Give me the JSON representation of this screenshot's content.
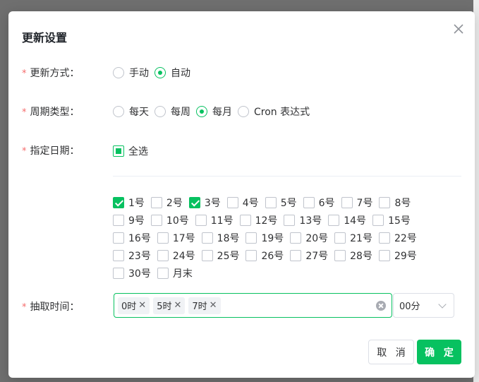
{
  "dialog": {
    "title": "更新设置",
    "cancel_label": "取 消",
    "confirm_label": "确 定"
  },
  "form": {
    "required_mark": "*",
    "update_mode": {
      "label": "更新方式：",
      "options": [
        {
          "label": "手动",
          "selected": false
        },
        {
          "label": "自动",
          "selected": true
        }
      ]
    },
    "period_type": {
      "label": "周期类型：",
      "options": [
        {
          "label": "每天",
          "selected": false
        },
        {
          "label": "每周",
          "selected": false
        },
        {
          "label": "每月",
          "selected": true
        },
        {
          "label": "Cron 表达式",
          "selected": false
        }
      ]
    },
    "dates": {
      "label": "指定日期：",
      "select_all_label": "全选",
      "select_all_state": "indeterminate",
      "rows": [
        [
          {
            "label": "1号",
            "checked": true
          },
          {
            "label": "2号",
            "checked": false
          },
          {
            "label": "3号",
            "checked": true
          },
          {
            "label": "4号",
            "checked": false
          },
          {
            "label": "5号",
            "checked": false
          },
          {
            "label": "6号",
            "checked": false
          },
          {
            "label": "7号",
            "checked": false
          },
          {
            "label": "8号",
            "checked": false
          }
        ],
        [
          {
            "label": "9号",
            "checked": false
          },
          {
            "label": "10号",
            "checked": false
          },
          {
            "label": "11号",
            "checked": false
          },
          {
            "label": "12号",
            "checked": false
          },
          {
            "label": "13号",
            "checked": false
          },
          {
            "label": "14号",
            "checked": false
          },
          {
            "label": "15号",
            "checked": false
          }
        ],
        [
          {
            "label": "16号",
            "checked": false
          },
          {
            "label": "17号",
            "checked": false
          },
          {
            "label": "18号",
            "checked": false
          },
          {
            "label": "19号",
            "checked": false
          },
          {
            "label": "20号",
            "checked": false
          },
          {
            "label": "21号",
            "checked": false
          },
          {
            "label": "22号",
            "checked": false
          }
        ],
        [
          {
            "label": "23号",
            "checked": false
          },
          {
            "label": "24号",
            "checked": false
          },
          {
            "label": "25号",
            "checked": false
          },
          {
            "label": "26号",
            "checked": false
          },
          {
            "label": "27号",
            "checked": false
          },
          {
            "label": "28号",
            "checked": false
          },
          {
            "label": "29号",
            "checked": false
          }
        ],
        [
          {
            "label": "30号",
            "checked": false
          },
          {
            "label": "月末",
            "checked": false
          }
        ]
      ]
    },
    "extract_time": {
      "label": "抽取时间：",
      "hour_tags": [
        "0时",
        "5时",
        "7时"
      ],
      "minute_value": "00分"
    }
  },
  "colors": {
    "accent": "#07c160",
    "required": "#f56c6c"
  }
}
